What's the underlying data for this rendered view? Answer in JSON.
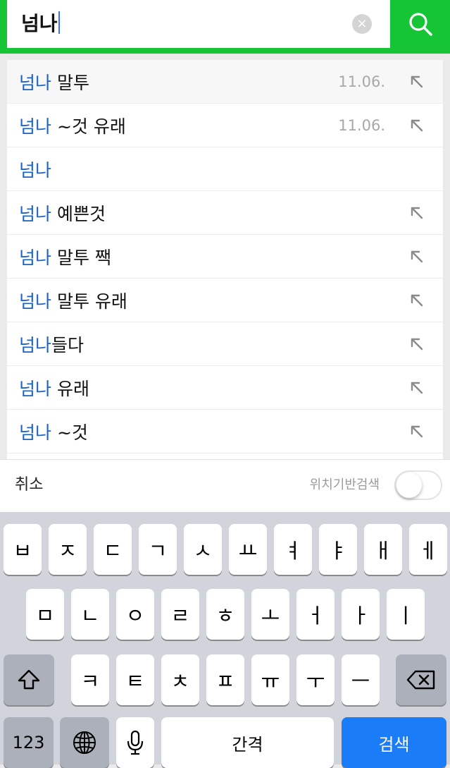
{
  "search": {
    "query": "넘나",
    "clear_icon": "×"
  },
  "suggestions": [
    {
      "highlight": "넘나",
      "rest": " 말투",
      "date": "11.06.",
      "fill": true
    },
    {
      "highlight": "넘나",
      "rest": " ~것 유래",
      "date": "11.06.",
      "fill": true
    },
    {
      "highlight": "넘나",
      "rest": "",
      "date": "",
      "fill": false
    },
    {
      "highlight": "넘나",
      "rest": " 예쁜것",
      "date": "",
      "fill": true
    },
    {
      "highlight": "넘나",
      "rest": " 말투 짹",
      "date": "",
      "fill": true
    },
    {
      "highlight": "넘나",
      "rest": " 말투 유래",
      "date": "",
      "fill": true
    },
    {
      "highlight": "넘나",
      "rest": "들다",
      "date": "",
      "fill": true
    },
    {
      "highlight": "넘나",
      "rest": " 유래",
      "date": "",
      "fill": true
    },
    {
      "highlight": "넘나",
      "rest": " ~것",
      "date": "",
      "fill": true
    }
  ],
  "footer": {
    "cancel_label": "취소",
    "location_label": "위치기반검색",
    "location_enabled": false
  },
  "keyboard": {
    "row1": [
      "ㅂ",
      "ㅈ",
      "ㄷ",
      "ㄱ",
      "ㅅ",
      "ㅛ",
      "ㅕ",
      "ㅑ",
      "ㅐ",
      "ㅔ"
    ],
    "row2": [
      "ㅁ",
      "ㄴ",
      "ㅇ",
      "ㄹ",
      "ㅎ",
      "ㅗ",
      "ㅓ",
      "ㅏ",
      "ㅣ"
    ],
    "row3": [
      "ㅋ",
      "ㅌ",
      "ㅊ",
      "ㅍ",
      "ㅠ",
      "ㅜ",
      "ㅡ"
    ],
    "numbers_label": "123",
    "space_label": "간격",
    "search_label": "검색",
    "icons": {
      "shift": "shift-icon",
      "delete": "delete-icon",
      "globe": "globe-icon",
      "mic": "microphone-icon"
    }
  },
  "colors": {
    "brand_green": "#15c536",
    "highlight_blue": "#1a62c6",
    "search_key_blue": "#1a7cf6"
  }
}
